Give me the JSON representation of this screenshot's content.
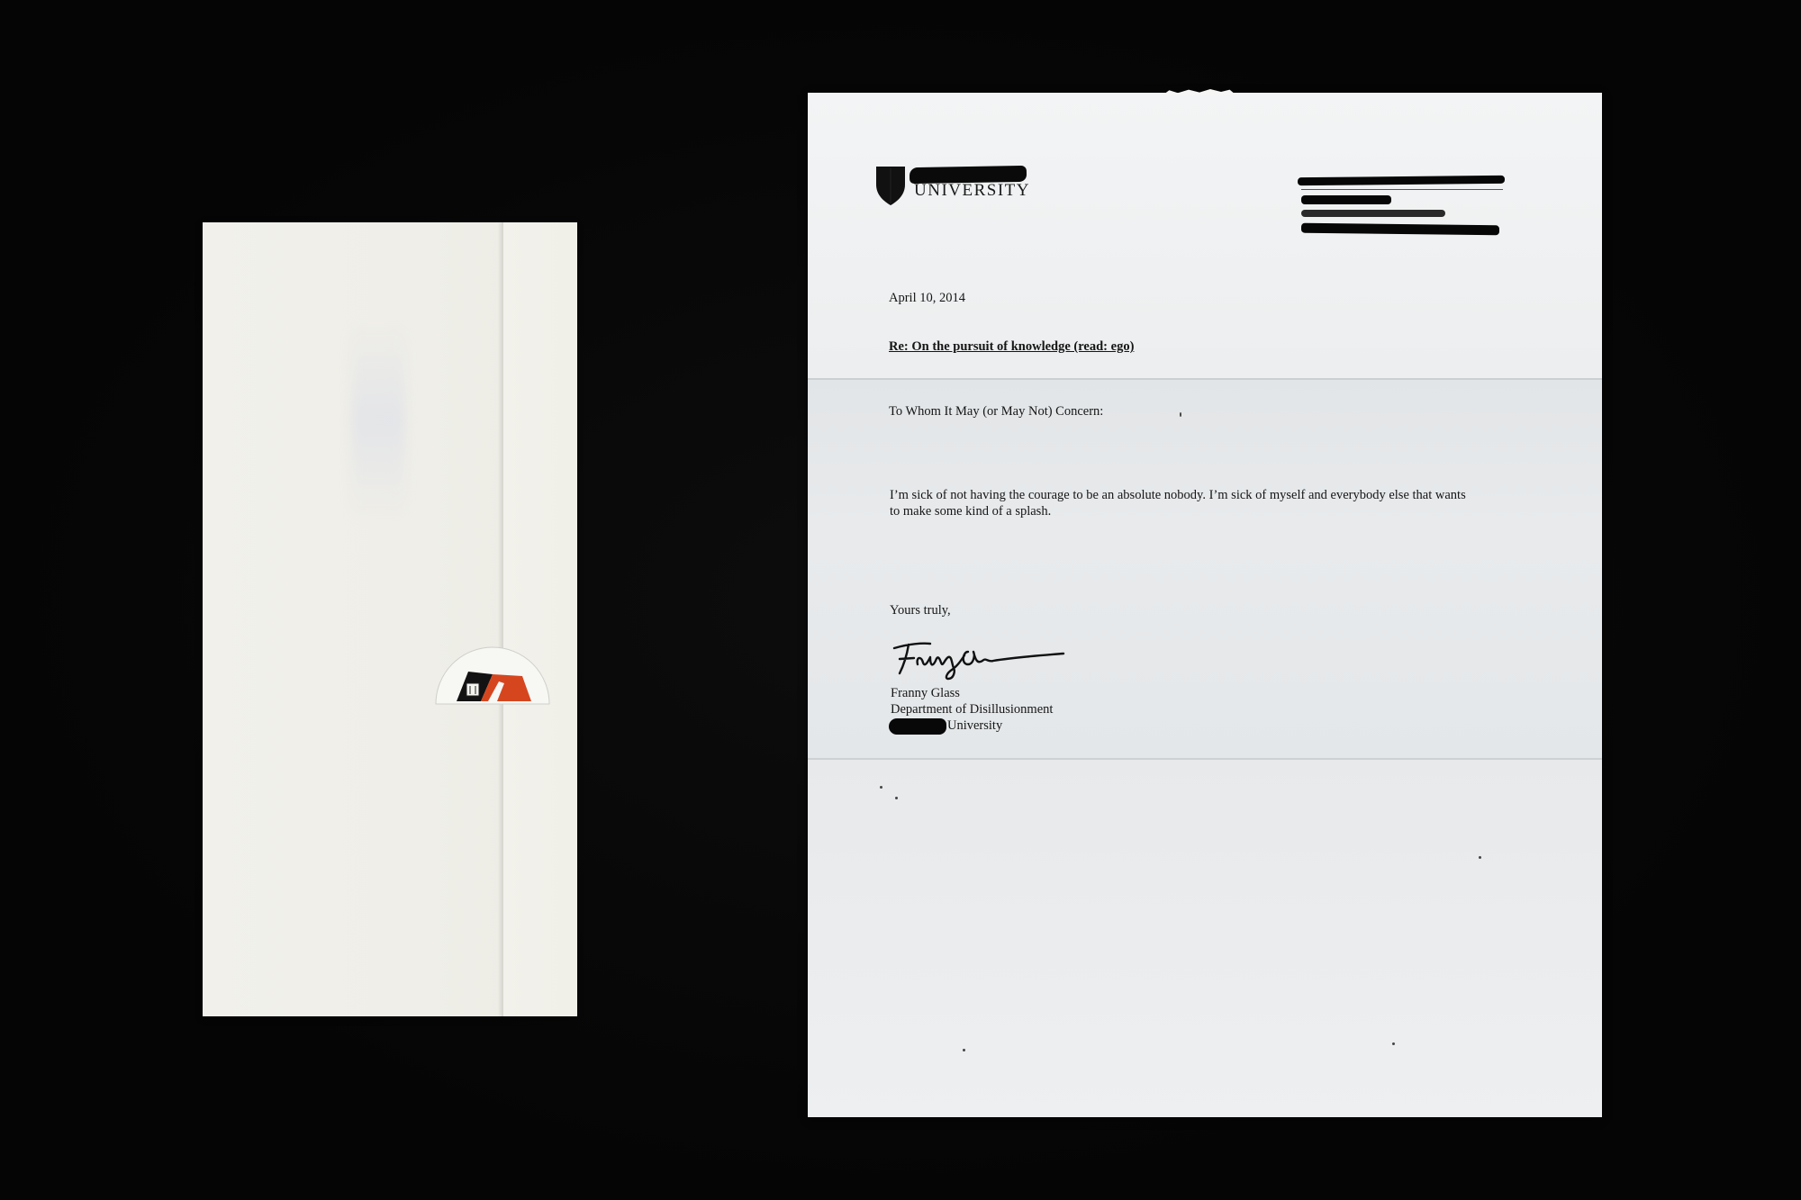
{
  "scene": {
    "background_color": "#050505",
    "paper_color": "#eef0f1",
    "envelope_color": "#f0efe9"
  },
  "envelope": {
    "seal_colors": [
      "#111111",
      "#d5461f"
    ],
    "seal_icon": "university-seal-sticker"
  },
  "letterhead": {
    "crest_icon": "shield-icon",
    "institution_name": "UNIVERSITY",
    "name_redacted": true,
    "address_redacted": true
  },
  "letter": {
    "date": "April 10, 2014",
    "subject": "Re: On the pursuit of knowledge (read: ego)",
    "salutation": "To Whom It May (or May Not) Concern:",
    "body": "I’m sick of not having the courage to be an absolute nobody. I’m sick of myself and everybody else that wants to make some kind of a splash.",
    "closing": "Yours truly,",
    "signature_icon": "handwritten-signature",
    "sender_name": "Franny Glass",
    "sender_department": "Department of Disillusionment",
    "sender_institution": "University"
  }
}
